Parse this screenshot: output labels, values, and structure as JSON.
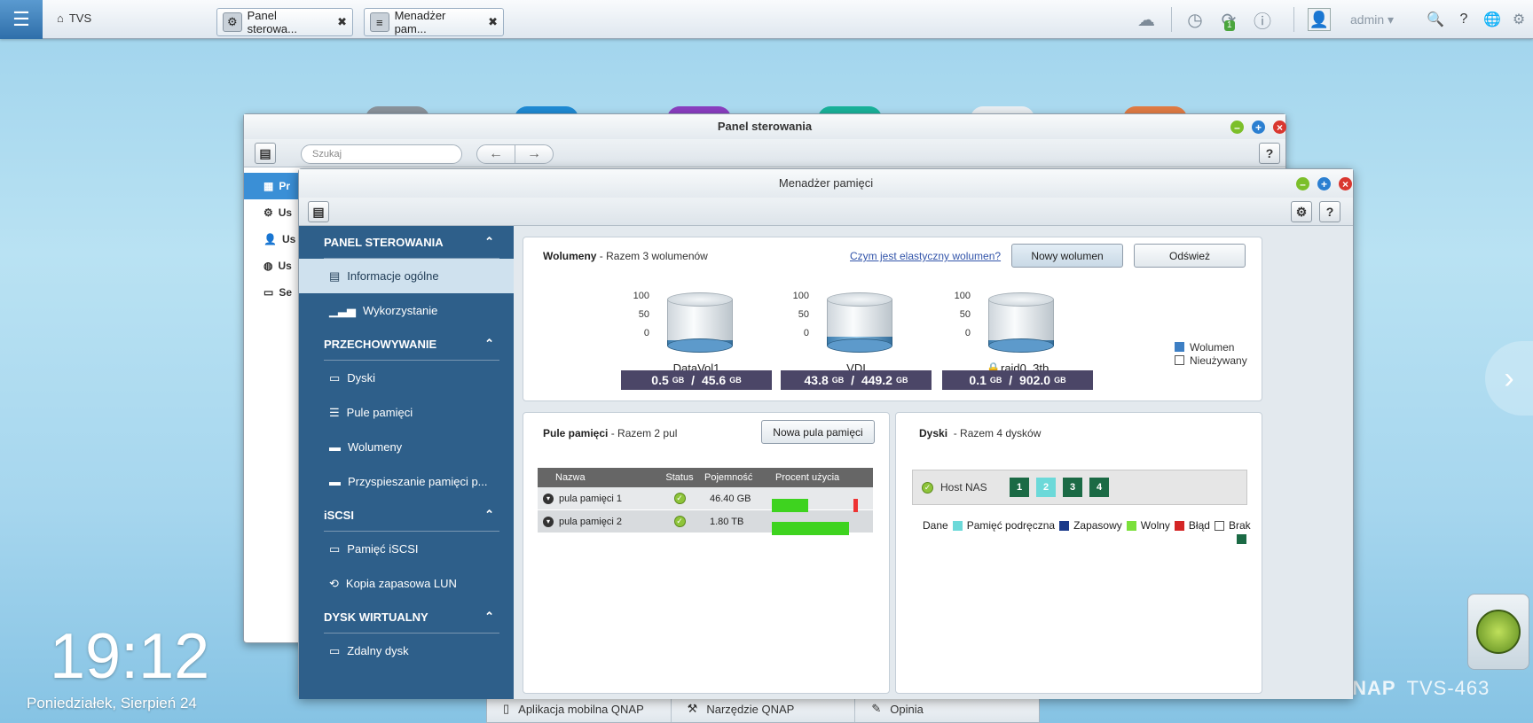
{
  "topbar": {
    "home_label": "TVS",
    "tabs": [
      {
        "label": "Panel sterowa..."
      },
      {
        "label": "Menadżer pam..."
      }
    ],
    "badge": "1",
    "user": "admin"
  },
  "desktop": {
    "time": "19:12",
    "date": "Poniedziałek, Sierpień 24",
    "brand": "QNAP",
    "model": "TVS-463",
    "bottom": [
      {
        "label": "Aplikacja mobilna QNAP"
      },
      {
        "label": "Narzędzie QNAP"
      },
      {
        "label": "Opinia"
      }
    ]
  },
  "panel_window": {
    "title": "Panel sterowania",
    "search_placeholder": "Szukaj",
    "side": [
      "Pr",
      "Us",
      "Us",
      "Us",
      "Se"
    ]
  },
  "storage_window": {
    "title": "Menadżer pamięci",
    "nav": {
      "sections": [
        {
          "label": "PANEL STEROWANIA",
          "items": [
            "Informacje ogólne",
            "Wykorzystanie"
          ]
        },
        {
          "label": "PRZECHOWYWANIE",
          "items": [
            "Dyski",
            "Pule pamięci",
            "Wolumeny",
            "Przyspieszanie pamięci p..."
          ]
        },
        {
          "label": "iSCSI",
          "items": [
            "Pamięć iSCSI",
            "Kopia zapasowa LUN"
          ]
        },
        {
          "label": "DYSK WIRTUALNY",
          "items": [
            "Zdalny dysk"
          ]
        }
      ]
    },
    "volumes": {
      "title": "Wolumeny",
      "subtitle": "- Razem 3 wolumenów",
      "link": "Czym jest elastyczny wolumen?",
      "new_btn": "Nowy wolumen",
      "refresh_btn": "Odśwież",
      "axis": [
        "100",
        "50",
        "0"
      ],
      "items": [
        {
          "name": "DataVol1",
          "used": "0.5",
          "total": "45.6",
          "unit": "GB",
          "fill": 0.01
        },
        {
          "name": "VDI",
          "used": "43.8",
          "total": "449.2",
          "unit": "GB",
          "fill": 0.1
        },
        {
          "name": "raid0_3tb",
          "used": "0.1",
          "total": "902.0",
          "unit": "GB",
          "fill": 0.01
        }
      ],
      "legend": [
        {
          "label": "Wolumen",
          "color": "#3d7fc4"
        },
        {
          "label": "Nieużywany",
          "color": "#ffffff"
        }
      ]
    },
    "pools": {
      "title": "Pule pamięci",
      "subtitle": "- Razem 2 pul",
      "new_btn": "Nowa pula pamięci",
      "columns": [
        "Nazwa",
        "Status",
        "Pojemność",
        "Procent użycia"
      ],
      "rows": [
        {
          "name": "pula pamięci 1",
          "capacity": "46.40 GB",
          "usage": 0.37
        },
        {
          "name": "pula pamięci 2",
          "capacity": "1.80 TB",
          "usage": 0.78
        }
      ]
    },
    "disks": {
      "title": "Dyski",
      "subtitle": "- Razem 4 dysków",
      "host": "Host NAS",
      "slots": [
        {
          "n": "1",
          "color": "#1b6a45"
        },
        {
          "n": "2",
          "color": "#6cd9d9"
        },
        {
          "n": "3",
          "color": "#1b6a45"
        },
        {
          "n": "4",
          "color": "#1b6a45"
        }
      ],
      "legend": [
        {
          "label": "Dane",
          "color": "#6cd9d9"
        },
        {
          "label": "Pamięć podręczna",
          "color": "#1a3a8a"
        },
        {
          "label": "Zapasowy",
          "color": "#7be03a"
        },
        {
          "label": "Wolny",
          "color": "#d42626"
        },
        {
          "label": "Błąd",
          "color": "#ffffff"
        },
        {
          "label": "Brak",
          "color": "#1b6a45"
        }
      ]
    }
  }
}
